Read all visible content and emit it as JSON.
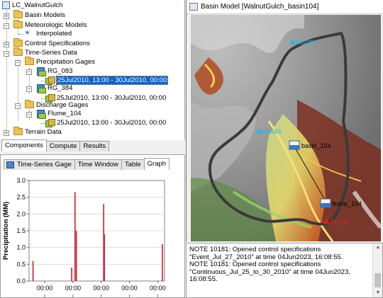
{
  "tree": {
    "root": "LC_WalnutGulch",
    "basin_models": "Basin Models",
    "meteorologic_models": "Meteorologic Models",
    "met_model": "Interpolated",
    "control_specs": "Control Specifications",
    "time_series": "Time-Series Data",
    "precip_gages": "Precipitation Gages",
    "gage1": "RG_083",
    "gage1_window": "25Jul2010, 13:00 - 30Jul2010, 00:00",
    "gage2": "RG_384",
    "gage2_window": "25Jul2010, 13:00 - 30Jul2010, 00:00",
    "discharge_gages": "Discharge Gages",
    "gage3": "Flume_104",
    "gage3_window": "25Jul2010, 13:00 - 30Jul2010, 00:00",
    "terrain": "Terrain Data"
  },
  "explorer_tabs": [
    "Components",
    "Compute",
    "Results"
  ],
  "gage_tabs": [
    "Time-Series Gage",
    "Time Window",
    "Table",
    "Graph"
  ],
  "chart_data": {
    "type": "bar",
    "ylabel": "Precipitation (MM)",
    "ylim": [
      0,
      3.0
    ],
    "yticks": [
      "3.0",
      "2.5",
      "2.0",
      "1.5",
      "1.0",
      "0.5",
      "0.0"
    ],
    "xticks": [
      "00:00",
      "00:00",
      "00:00",
      "00:00",
      "00:00"
    ],
    "bar_color": "#cc1e2e",
    "bars": [
      {
        "x": 0.02,
        "value": 0.6
      },
      {
        "x": 0.31,
        "value": 0.4
      },
      {
        "x": 0.335,
        "value": 2.65
      },
      {
        "x": 0.345,
        "value": 1.5
      },
      {
        "x": 0.55,
        "value": 2.3
      },
      {
        "x": 0.555,
        "value": 1.4
      },
      {
        "x": 0.99,
        "value": 1.1
      }
    ]
  },
  "map": {
    "title": "Basin Model [WalnutGulch_basin104]",
    "labels": {
      "rg083": "RG083",
      "rg384": "RG384",
      "basin": "basin_104",
      "flume": "flume_104",
      "fl104": "FL104"
    },
    "label_color": "#29b6e6",
    "outlet_color": "#e61e1e"
  },
  "log": [
    "NOTE 10181:  Opened control specifications",
    "\"Event_Jul_27_2010\" at time 04Jun2023, 16:08:55.",
    "NOTE 10181:  Opened control specifications",
    "\"Continuous_Jul_25_to_30_2010\" at time 04Jun2023,",
    "16:08:55."
  ]
}
